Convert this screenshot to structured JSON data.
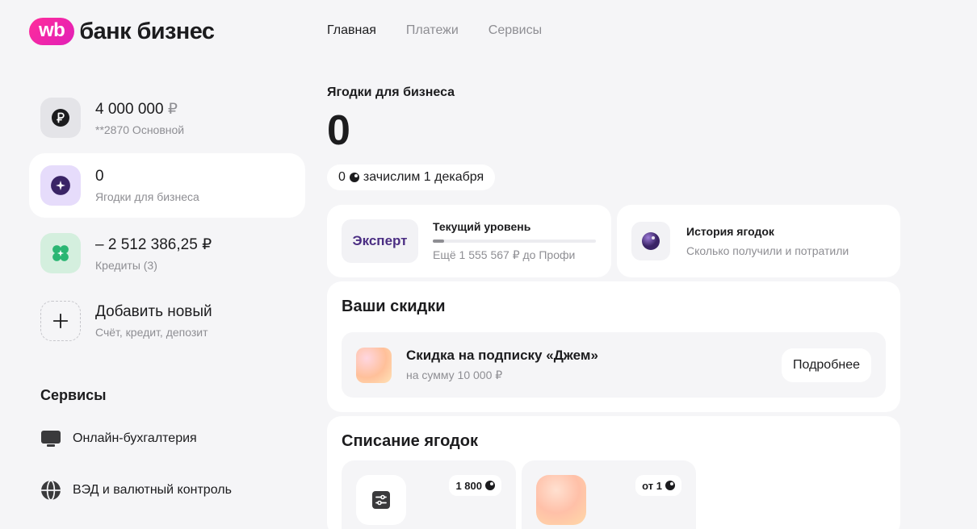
{
  "brand": {
    "badge": "wb",
    "name": "банк бизнес"
  },
  "nav": {
    "items": [
      "Главная",
      "Платежи",
      "Сервисы"
    ]
  },
  "accounts": [
    {
      "title": "4 000 000",
      "currency": "₽",
      "subtitle": "**2870 Основной",
      "icon": "ruble-icon"
    },
    {
      "title": "0",
      "subtitle": "Ягодки для бизнеса",
      "icon": "sparkle-icon"
    },
    {
      "title": "– 2 512 386,25 ₽",
      "subtitle": "Кредиты (3)",
      "icon": "clover-icon"
    },
    {
      "title": "Добавить новый",
      "subtitle": "Счёт, кредит, депозит",
      "icon": "plus-icon"
    }
  ],
  "services": {
    "title": "Сервисы",
    "items": [
      {
        "label": "Онлайн-бухгалтерия",
        "icon": "monitor-icon"
      },
      {
        "label": "ВЭД и валютный контроль",
        "icon": "globe-icon"
      }
    ]
  },
  "main": {
    "title": "Ягодки для бизнеса",
    "balance": "0",
    "pending": {
      "amount": "0",
      "text": "зачислим 1 декабря"
    },
    "level": {
      "badge": "Эксперт",
      "title": "Текущий уровень",
      "subtitle": "Ещё 1 555 567 ₽ до Профи",
      "progress": 0.07
    },
    "history": {
      "title": "История ягодок",
      "subtitle": "Сколько получили и потратили"
    },
    "discounts": {
      "title": "Ваши скидки",
      "item": {
        "title": "Скидка на подписку «Джем»",
        "subtitle": "на сумму 10 000 ₽",
        "button": "Подробнее"
      }
    },
    "writeoff": {
      "title": "Списание ягодок",
      "cards": [
        {
          "price": "1 800"
        },
        {
          "price": "от 1"
        }
      ]
    }
  },
  "colors": {
    "brand": "#ff2d9a",
    "accent_purple": "#4b2e83",
    "background": "#f5f5f7"
  }
}
